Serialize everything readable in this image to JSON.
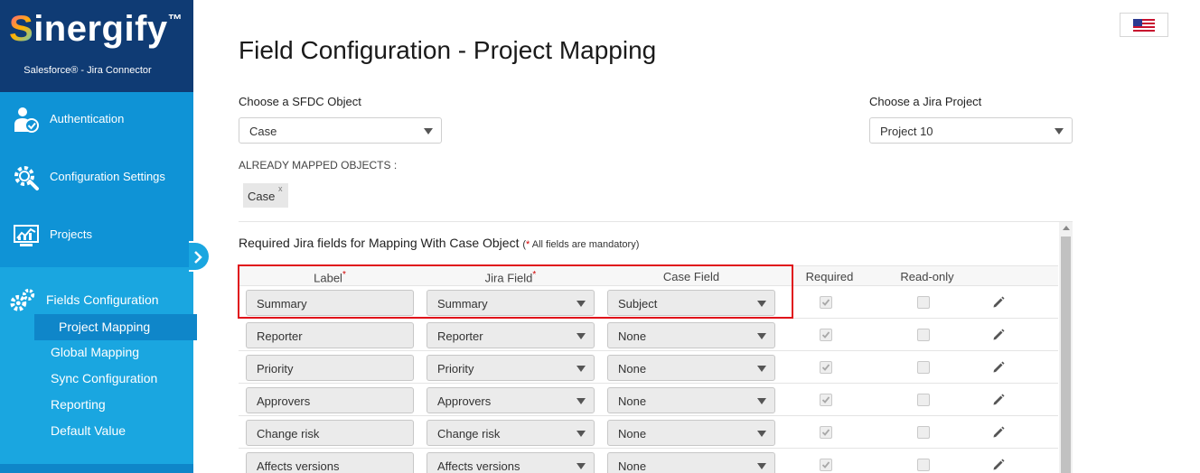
{
  "brand": {
    "name": "Sinergify",
    "first_letter": "S",
    "rest": "inergify",
    "trademark": "™",
    "subtitle": "Salesforce® - Jira Connector"
  },
  "sidebar": {
    "items": [
      {
        "label": "Authentication",
        "icon": "user-check-icon"
      },
      {
        "label": "Configuration Settings",
        "icon": "gear-search-icon"
      },
      {
        "label": "Projects",
        "icon": "monitor-chart-icon"
      },
      {
        "label": "Fields Configuration",
        "icon": "gears-icon"
      }
    ],
    "sub_items": [
      {
        "label": "Project Mapping",
        "active": true
      },
      {
        "label": "Global Mapping"
      },
      {
        "label": "Sync Configuration"
      },
      {
        "label": "Reporting"
      },
      {
        "label": "Default Value"
      }
    ]
  },
  "header": {
    "title": "Field Configuration - Project Mapping",
    "language_icon": "us-flag-icon"
  },
  "filters": {
    "sfdc_label": "Choose a SFDC Object",
    "sfdc_value": "Case",
    "jira_label": "Choose a Jira Project",
    "jira_value": "Project 10"
  },
  "mapped": {
    "title": "ALREADY MAPPED OBJECTS :",
    "chips": [
      {
        "label": "Case",
        "remove": "x"
      }
    ]
  },
  "panel": {
    "title": "Required Jira fields for Mapping With Case Object",
    "note_star": "*",
    "note": " All fields are mandatory)",
    "note_open": "("
  },
  "table": {
    "headers": {
      "label": "Label",
      "jira_field": "Jira Field",
      "case_field": "Case Field",
      "required": "Required",
      "read_only": "Read-only",
      "star": "*"
    },
    "rows": [
      {
        "label": "Summary",
        "jira_field": "Summary",
        "case_field": "Subject",
        "required": true,
        "read_only": false
      },
      {
        "label": "Reporter",
        "jira_field": "Reporter",
        "case_field": "None",
        "required": true,
        "read_only": false
      },
      {
        "label": "Priority",
        "jira_field": "Priority",
        "case_field": "None",
        "required": true,
        "read_only": false
      },
      {
        "label": "Approvers",
        "jira_field": "Approvers",
        "case_field": "None",
        "required": true,
        "read_only": false
      },
      {
        "label": "Change risk",
        "jira_field": "Change risk",
        "case_field": "None",
        "required": true,
        "read_only": false
      },
      {
        "label": "Affects versions",
        "jira_field": "Affects versions",
        "case_field": "None",
        "required": true,
        "read_only": false
      }
    ]
  },
  "colors": {
    "sidebar": "#1aa6e0",
    "brand_bg": "#0f3b74",
    "highlight": "#e0121a"
  }
}
